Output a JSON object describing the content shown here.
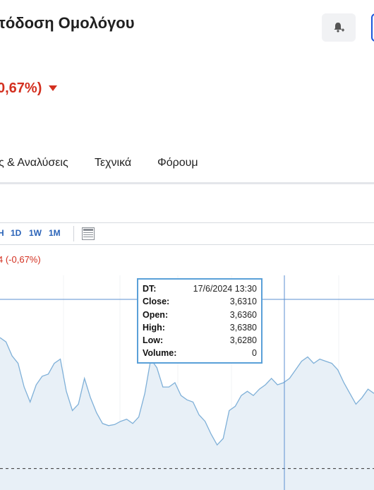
{
  "header": {
    "title": "τόδοση Ομολόγου",
    "change_text": "0,67%)"
  },
  "tabs": [
    {
      "label": "ς & Αναλύσεις"
    },
    {
      "label": "Τεχνικά"
    },
    {
      "label": "Φόρουμ"
    }
  ],
  "toolbar": {
    "timeframes": [
      "H",
      "1D",
      "1W",
      "1M"
    ]
  },
  "chart_header": {
    "change": "4  (-0,67%)"
  },
  "tooltip": {
    "rows": [
      {
        "key": "DT:",
        "value": "17/6/2024 13:30"
      },
      {
        "key": "Close:",
        "value": "3,6310"
      },
      {
        "key": "Open:",
        "value": "3,6360"
      },
      {
        "key": "High:",
        "value": "3,6380"
      },
      {
        "key": "Low:",
        "value": "3,6280"
      },
      {
        "key": "Volume:",
        "value": "0"
      }
    ]
  },
  "colors": {
    "negative": "#d32f1f",
    "accent": "#2a63b8",
    "line": "#7fb0d8",
    "fill": "#e8f0f7"
  },
  "chart_data": {
    "type": "area",
    "values": [
      3.6372,
      3.6368,
      3.6355,
      3.6348,
      3.6326,
      3.6312,
      3.6328,
      3.6336,
      3.6338,
      3.6348,
      3.6352,
      3.6322,
      3.6304,
      3.631,
      3.6334,
      3.6316,
      3.6302,
      3.6292,
      3.629,
      3.6291,
      3.6294,
      3.6296,
      3.6292,
      3.6298,
      3.632,
      3.6352,
      3.6344,
      3.6326,
      3.6326,
      3.633,
      3.6318,
      3.6314,
      3.6312,
      3.63,
      3.6294,
      3.6282,
      3.6272,
      3.6278,
      3.6304,
      3.6308,
      3.6318,
      3.6322,
      3.6318,
      3.6324,
      3.6328,
      3.6334,
      3.6328,
      3.633,
      3.6334,
      3.6342,
      3.635,
      3.6354,
      3.6348,
      3.6352,
      3.635,
      3.6348,
      3.6342,
      3.633,
      3.632,
      3.631,
      3.6316,
      3.6324,
      3.632
    ],
    "reference_line": 3.625,
    "ylim": [
      3.623,
      3.643
    ],
    "crosshair": "17/6/2024 13:30"
  }
}
